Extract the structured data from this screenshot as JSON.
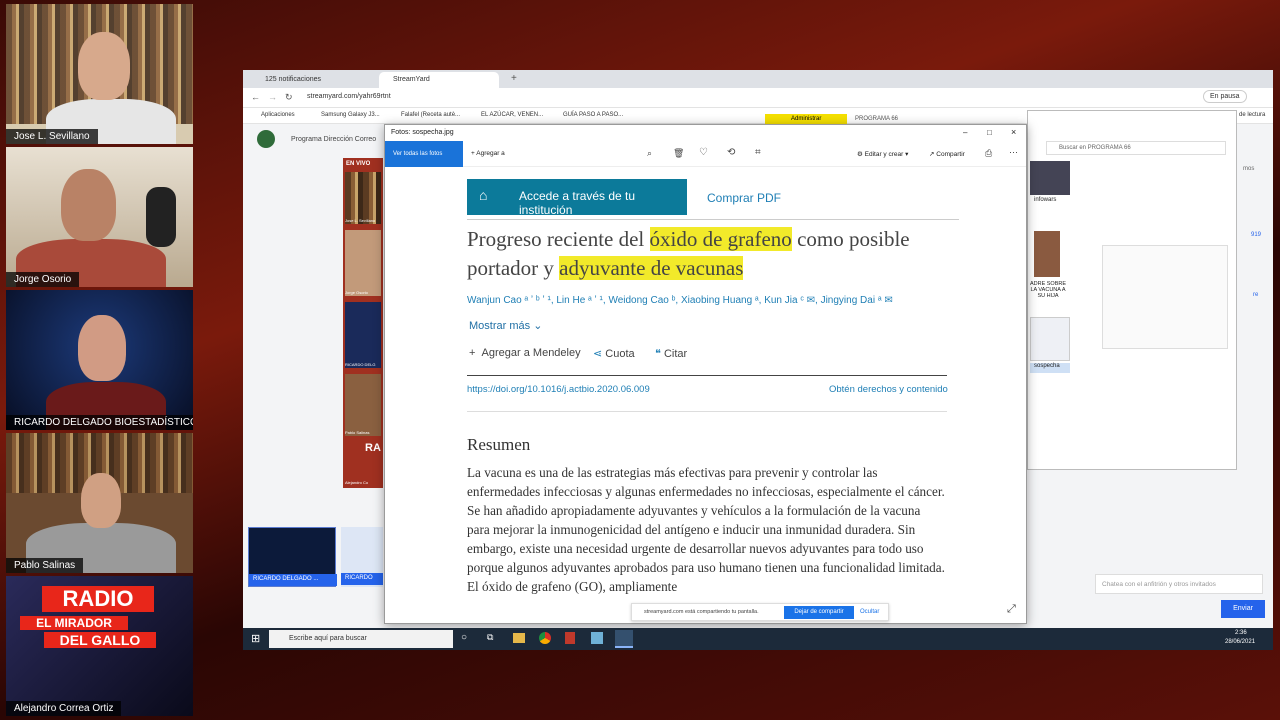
{
  "participants": [
    {
      "name": "Jose L. Sevillano"
    },
    {
      "name": "Jorge Osorio"
    },
    {
      "name": "RICARDO DELGADO BIOESTADÍSTICO"
    },
    {
      "name": "Pablo Salinas"
    },
    {
      "name": "Alejandro Correa Ortiz"
    }
  ],
  "radio_logo": {
    "line1": "RADIO",
    "line2": "EL MIRADOR",
    "line3": "DEL GALLO"
  },
  "browser": {
    "tabs": [
      "125 notificaciones",
      "StreamYard"
    ],
    "url": "streamyard.com/yahr69rtnt",
    "profile": "En pausa",
    "bookmarks": [
      "Aplicaciones",
      "Samsung Galaxy J3...",
      "Falafel (Receta autè...",
      "EL AZÚCAR, VENEN...",
      "GUÍA PASO A PASO..."
    ],
    "reading_list": "de lectura",
    "page_header": "Programa Dirección Correo",
    "admin_chip": "Administrar",
    "programa_title": "PROGRAMA 66",
    "live_badge": "EN VIVO",
    "preview_names": [
      "Jose L. Sevillano",
      "Jorge Osorio",
      "RICARDO DELG",
      "Pablo Salinas",
      "Alejandro Co"
    ],
    "radio_mini": "RA",
    "bottom_tile": "RICARDO DELGADO ...",
    "bottom_tile2": "RICARDO",
    "chat_placeholder": "Chatea con el anfitrión y otros invitados",
    "send_label": "Enviar"
  },
  "explorer": {
    "search_placeholder": "Buscar en PROGRAMA 66",
    "items": [
      "infowars",
      "ADRE SOBRE LA VACUNA A SU HIJA",
      "sospecha"
    ],
    "side_labels": [
      "mos",
      "919",
      "re"
    ]
  },
  "viewer": {
    "title": "Fotos: sospecha.jpg",
    "view_all": "Ver todas las fotos",
    "add_to": "Agregar a",
    "edit_create": "Editar y crear",
    "share": "Compartir"
  },
  "article": {
    "access_btn": "Accede a través de tu institución",
    "buy_pdf": "Comprar PDF",
    "title_pre": "Progreso reciente del ",
    "title_hl1": "óxido de grafeno",
    "title_mid": " como posible portador y ",
    "title_hl2": "adyuvante de vacunas",
    "authors": "Wanjun Cao ᵃ ʼ ᵇ ʼ ¹, Lin He ᵃ ʼ ¹, Weidong Cao ᵇ, Xiaobing Huang ᵃ, Kun Jia ᶜ ✉, Jingying Dai ᵃ ✉",
    "show_more": "Mostrar más",
    "mendeley": "Agregar a Mendeley",
    "cuota": "Cuota",
    "citar": "Citar",
    "doi": "https://doi.org/10.1016/j.actbio.2020.06.009",
    "rights": "Obtén derechos y contenido",
    "resumen": "Resumen",
    "body": "La vacuna es una de las estrategias más efectivas para prevenir y controlar las enfermedades infecciosas y algunas enfermedades no infecciosas, especialmente el cáncer. Se han añadido apropiadamente adyuvantes y vehículos a la formulación de la vacuna para mejorar la inmunogenicidad del antígeno e inducir una inmunidad duradera. Sin embargo, existe una necesidad urgente de desarrollar nuevos adyuvantes para todo uso porque algunos adyuvantes aprobados para uso humano tienen una funcionalidad limitada. El óxido de grafeno (GO), ampliamente"
  },
  "share_bar": {
    "text": "streamyard.com está compartiendo tu pantalla.",
    "stop": "Dejar de compartir",
    "hide": "Ocultar"
  },
  "taskbar": {
    "search": "Escribe aquí para buscar",
    "time": "2:36",
    "date": "28/06/2021"
  }
}
